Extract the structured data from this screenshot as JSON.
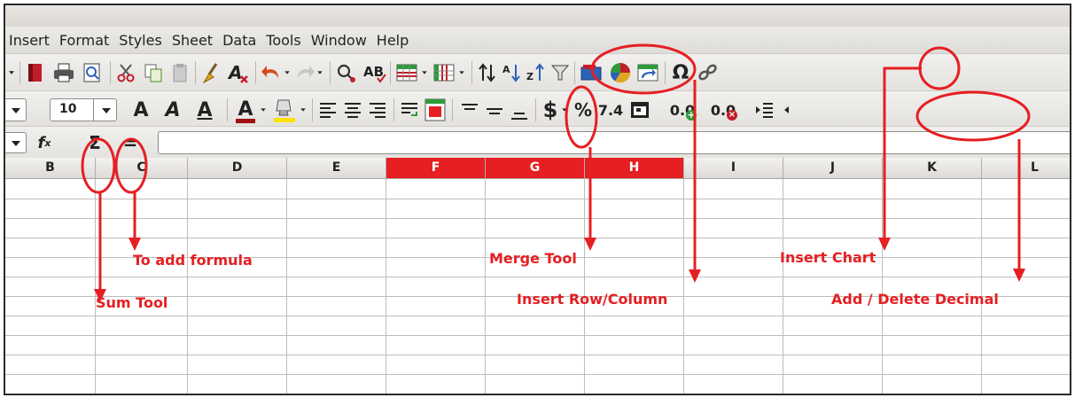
{
  "menubar": {
    "items": [
      "Insert",
      "Format",
      "Styles",
      "Sheet",
      "Data",
      "Tools",
      "Window",
      "Help"
    ]
  },
  "format_toolbar": {
    "font_size": "10",
    "currency_symbol": "$",
    "percent_symbol": "%",
    "number_format": "7.4",
    "add_decimal": "0.0",
    "delete_decimal": "0.0"
  },
  "formula_bar": {
    "fx_label": "f",
    "fx_sub": "x",
    "sum_symbol": "Σ",
    "equals_symbol": "=",
    "input_value": ""
  },
  "sheet": {
    "columns": [
      "B",
      "C",
      "D",
      "E",
      "F",
      "G",
      "H",
      "I",
      "J",
      "K",
      "L"
    ],
    "selected_columns": [
      "F",
      "G",
      "H"
    ],
    "selection_color": "#e51f22"
  },
  "annotations": {
    "color": "#e51f22",
    "labels": {
      "formula": "To add formula",
      "sum": "Sum Tool",
      "merge": "Merge Tool",
      "insert_row_col": "Insert Row/Column",
      "insert_chart": "Insert Chart",
      "decimal": "Add / Delete Decimal"
    }
  }
}
